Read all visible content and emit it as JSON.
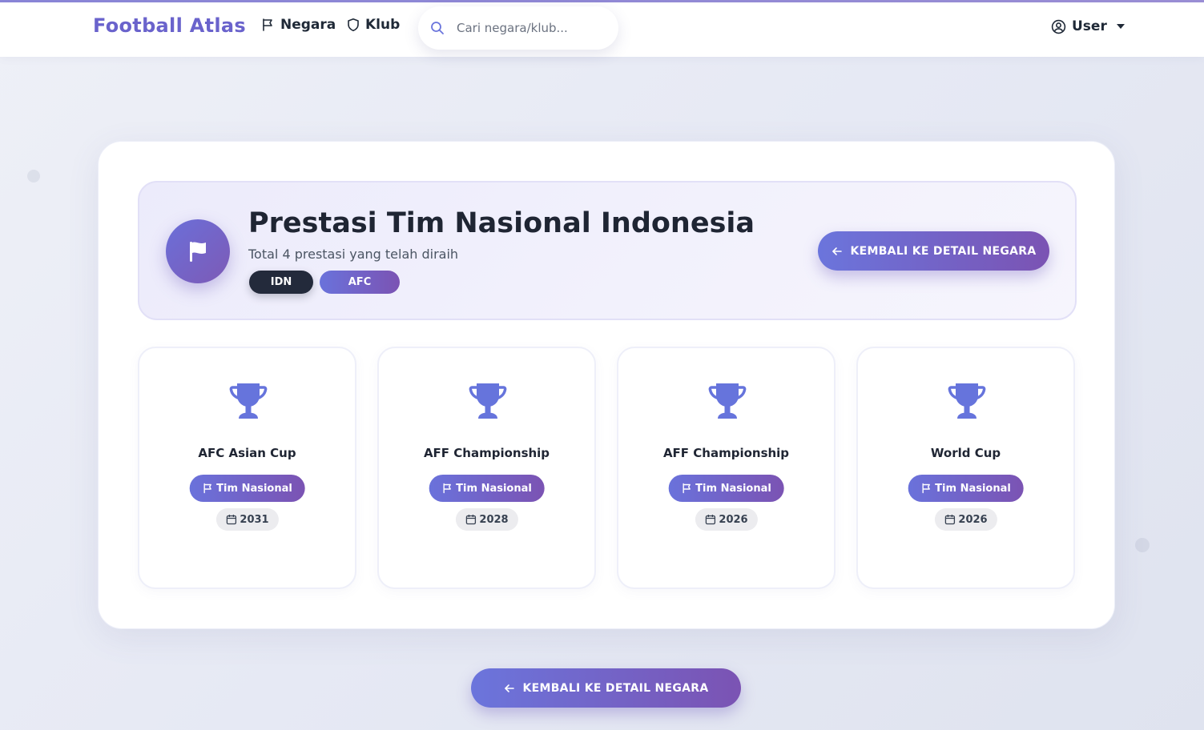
{
  "navbar": {
    "brand": "Football Atlas",
    "links": [
      {
        "label": "Negara",
        "icon": "flag-icon"
      },
      {
        "label": "Klub",
        "icon": "shield-icon"
      }
    ],
    "search_placeholder": "Cari negara/klub...",
    "user_label": "User"
  },
  "hero": {
    "icon": "flag-icon",
    "title": "Prestasi Tim Nasional Indonesia",
    "subtitle": "Total 4 prestasi yang telah diraih",
    "badges": [
      "IDN",
      "AFC"
    ],
    "back_button": "KEMBALI KE DETAIL NEGARA"
  },
  "trophies": [
    {
      "name": "AFC Asian Cup",
      "type": "Tim Nasional",
      "year": "2031"
    },
    {
      "name": "AFF Championship",
      "type": "Tim Nasional",
      "year": "2028"
    },
    {
      "name": "AFF Championship",
      "type": "Tim Nasional",
      "year": "2026"
    },
    {
      "name": "World Cup",
      "type": "Tim Nasional",
      "year": "2026"
    }
  ],
  "bottom_button": "KEMBALI KE DETAIL NEGARA",
  "colors": {
    "accent_start": "#6b75dc",
    "accent_end": "#7b53b3",
    "brand": "#6a63cc",
    "trophy": "#6674dc",
    "dark_badge": "#232a3b"
  }
}
